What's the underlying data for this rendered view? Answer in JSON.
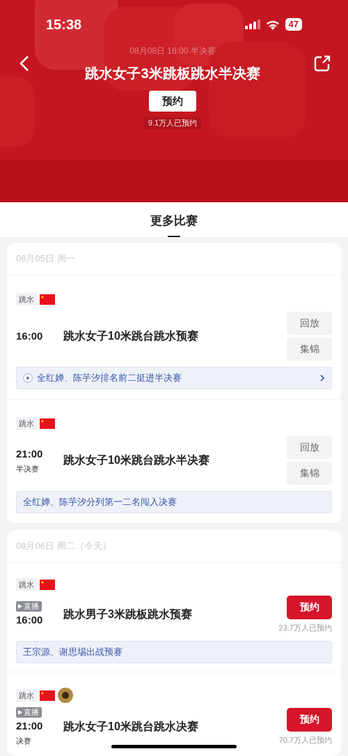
{
  "status_bar": {
    "time": "15:38",
    "battery": "47"
  },
  "header": {
    "subtitle": "08月08日 16:00 半决赛",
    "title": "跳水女子3米跳板跳水半决赛",
    "button": "预约",
    "count": "9.1万人已预约"
  },
  "tabs": [
    {
      "label": "更多比赛",
      "selected": true
    }
  ],
  "days": [
    {
      "date": "08月05日 周一",
      "events": [
        {
          "kind": "replay",
          "tag": "跳水",
          "badges": [
            {
              "kind": "flag"
            }
          ],
          "time": "16:00",
          "title": "跳水女子10米跳台跳水预赛",
          "buttons": [
            "回放",
            "集锦"
          ],
          "note": {
            "text": "全红婵、陈芋汐排名前二挺进半决赛",
            "video": true
          }
        },
        {
          "kind": "replay",
          "tag": "跳水",
          "badges": [
            {
              "kind": "flag"
            }
          ],
          "time": "21:00",
          "stage": "半决赛",
          "title": "跳水女子10米跳台跳水半决赛",
          "buttons": [
            "回放",
            "集锦"
          ],
          "note": {
            "text": "全红婵、陈芋汐分列第一二名闯入决赛",
            "video": false
          }
        }
      ]
    },
    {
      "date": "08月06日 周二（今天）",
      "events": [
        {
          "kind": "reserve",
          "tag": "跳水",
          "badges": [
            {
              "kind": "flag"
            }
          ],
          "live": "直播",
          "time": "16:00",
          "title": "跳水男子3米跳板跳水预赛",
          "button": "预约",
          "count": "23.7万人已预约",
          "note": {
            "text": "王宗源、谢思埸出战预赛",
            "video": false
          }
        },
        {
          "kind": "reserve",
          "tag": "跳水",
          "badges": [
            {
              "kind": "flag"
            },
            {
              "kind": "emblem"
            }
          ],
          "live": "直播",
          "time": "21:00",
          "stage": "决赛",
          "title": "跳水女子10米跳台跳水决赛",
          "button": "预约",
          "count": "70.7万人已预约"
        }
      ]
    }
  ]
}
